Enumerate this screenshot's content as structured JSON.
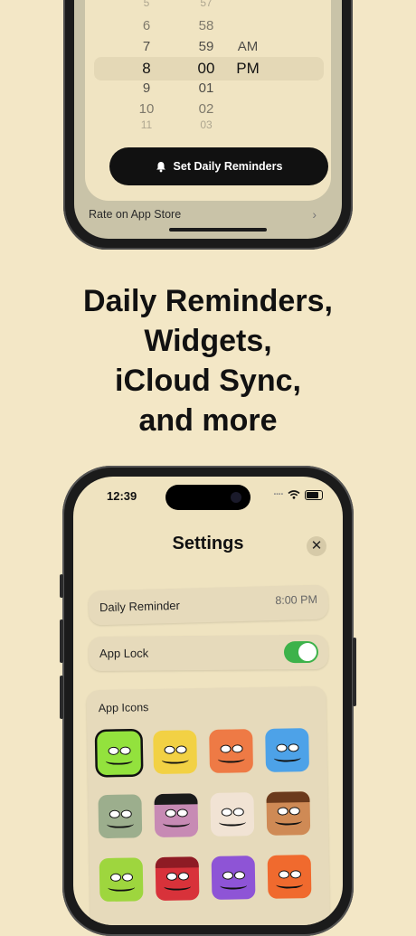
{
  "top_phone": {
    "picker": {
      "rows": [
        {
          "hour": "5",
          "minute": "57",
          "ampm": ""
        },
        {
          "hour": "6",
          "minute": "58",
          "ampm": ""
        },
        {
          "hour": "7",
          "minute": "59",
          "ampm": "AM"
        },
        {
          "hour": "8",
          "minute": "00",
          "ampm": "PM"
        },
        {
          "hour": "9",
          "minute": "01",
          "ampm": ""
        },
        {
          "hour": "10",
          "minute": "02",
          "ampm": ""
        },
        {
          "hour": "11",
          "minute": "03",
          "ampm": ""
        }
      ],
      "selected_index": 3
    },
    "set_button_label": "Set Daily Reminders",
    "rate_label": "Rate on App Store"
  },
  "headline": {
    "line1": "Daily Reminders,",
    "line2": "Widgets,",
    "line3": "iCloud Sync,",
    "line4": "and more"
  },
  "bottom_phone": {
    "status_time": "12:39",
    "title": "Settings",
    "close_label": "✕",
    "daily_reminder_label": "Daily Reminder",
    "daily_reminder_value": "8:00 PM",
    "app_lock_label": "App Lock",
    "app_lock_on": true,
    "app_icons_label": "App Icons",
    "app_icons": [
      {
        "name": "green-monster",
        "color": "#93e23d",
        "selected": true
      },
      {
        "name": "yellow-monster",
        "color": "#f2d144"
      },
      {
        "name": "orange-monster",
        "color": "#ee7a45"
      },
      {
        "name": "blue-monster",
        "color": "#4da2e8"
      },
      {
        "name": "olive-monster",
        "color": "#9cae8d"
      },
      {
        "name": "purple-monster",
        "color": "#c78ab4"
      },
      {
        "name": "pale-monster",
        "color": "#f1e3d4"
      },
      {
        "name": "brown-monster",
        "color": "#cf8a55"
      },
      {
        "name": "lime-monster",
        "color": "#9ed63e"
      },
      {
        "name": "red-devil-monster",
        "color": "#d8323a"
      },
      {
        "name": "violet-monster",
        "color": "#8e54d6"
      },
      {
        "name": "rainbow-monster",
        "color": "#f06a2e"
      }
    ]
  }
}
